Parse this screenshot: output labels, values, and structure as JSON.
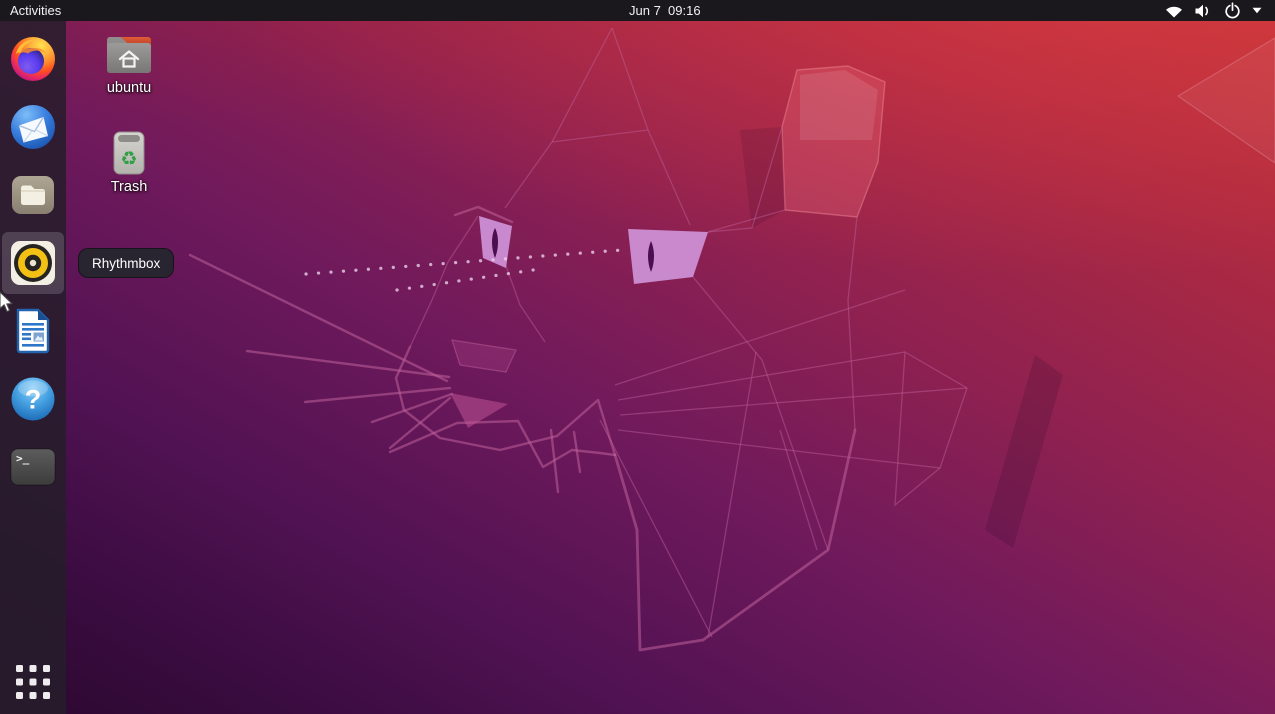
{
  "colors": {
    "topbar-bg": "#1a181c",
    "topbar-fg": "#f2f0f2",
    "dock-bg": "rgba(38,29,42,0.85)",
    "dock-highlight": "rgba(255,255,255,0.16)",
    "tooltip-bg": "#282430",
    "tooltip-fg": "#ffffff",
    "fossa-line": "#c0619b",
    "eye-fill": "#cf92d8",
    "wallpaper-top": "#c23539",
    "wallpaper-mid": "#711a5c",
    "wallpaper-bottom": "#2b082f"
  },
  "top_bar": {
    "activities_label": "Activities",
    "clock": "Jun 7  09:16"
  },
  "tray": {
    "icons": [
      "wifi",
      "volume",
      "power",
      "chevron-down"
    ]
  },
  "dock": {
    "items": [
      "firefox",
      "thunderbird",
      "files",
      "rhythmbox",
      "libreoffice-writer",
      "help",
      "terminal"
    ],
    "hovered_item": "rhythmbox",
    "show_apps": "show-applications"
  },
  "tooltip": {
    "text": "Rhythmbox"
  },
  "desktop": {
    "icons": [
      {
        "label": "ubuntu"
      },
      {
        "label": "Trash"
      }
    ]
  },
  "glyphs": {
    "help_question": "?",
    "terminal_prompt": ">_",
    "recycle_symbol": "♻"
  }
}
